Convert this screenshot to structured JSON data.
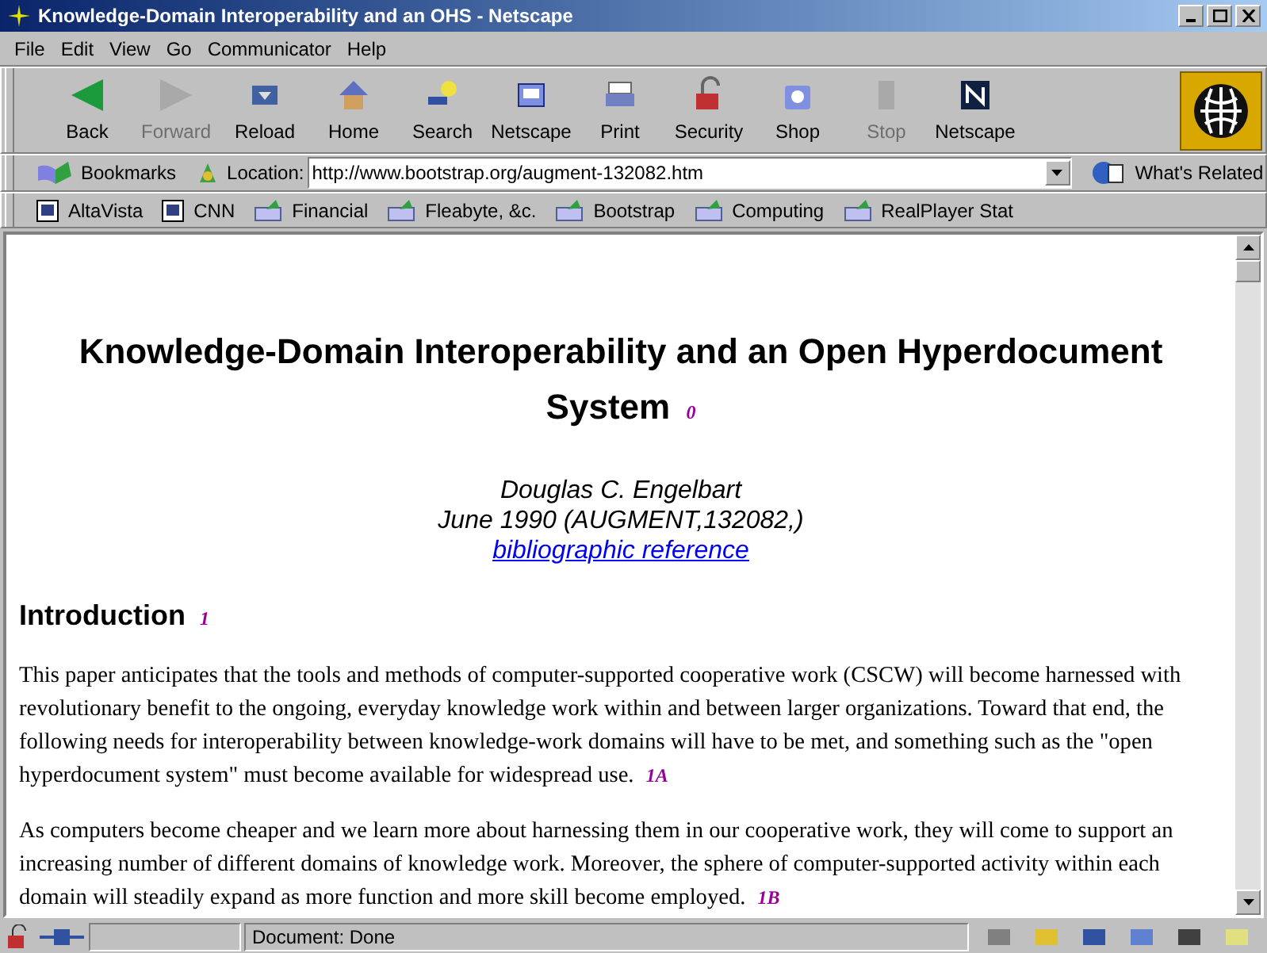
{
  "window": {
    "title": "Knowledge-Domain Interoperability and an OHS - Netscape"
  },
  "menu": [
    "File",
    "Edit",
    "View",
    "Go",
    "Communicator",
    "Help"
  ],
  "toolbar": [
    {
      "label": "Back",
      "disabled": false
    },
    {
      "label": "Forward",
      "disabled": true
    },
    {
      "label": "Reload",
      "disabled": false
    },
    {
      "label": "Home",
      "disabled": false
    },
    {
      "label": "Search",
      "disabled": false
    },
    {
      "label": "Netscape",
      "disabled": false
    },
    {
      "label": "Print",
      "disabled": false
    },
    {
      "label": "Security",
      "disabled": false
    },
    {
      "label": "Shop",
      "disabled": false
    },
    {
      "label": "Stop",
      "disabled": true
    },
    {
      "label": "Netscape",
      "disabled": false
    }
  ],
  "location_bar": {
    "bookmarks": "Bookmarks",
    "label": "Location:",
    "url": "http://www.bootstrap.org/augment-132082.htm",
    "related": "What's Related"
  },
  "personal_bar": [
    {
      "label": "AltaVista",
      "kind": "page"
    },
    {
      "label": "CNN",
      "kind": "page"
    },
    {
      "label": "Financial",
      "kind": "folder"
    },
    {
      "label": "Fleabyte, &c.",
      "kind": "folder"
    },
    {
      "label": "Bootstrap",
      "kind": "folder"
    },
    {
      "label": "Computing",
      "kind": "folder"
    },
    {
      "label": "RealPlayer Stat",
      "kind": "folder"
    }
  ],
  "document": {
    "title": "Knowledge-Domain Interoperability and an Open Hyperdocument System",
    "title_marker": "0",
    "author": "Douglas C. Engelbart",
    "date": "June 1990 (AUGMENT,132082,)",
    "reference": "bibliographic reference",
    "section": "Introduction",
    "section_marker": "1",
    "paragraphs": [
      {
        "text": "This paper anticipates that the tools and methods of computer-supported cooperative work (CSCW) will become harnessed with revolutionary benefit to the ongoing, everyday knowledge work within and between larger organizations. Toward that end, the following needs for interoperability between knowledge-work domains will have to be met, and something such as the \"open hyperdocument system\" must become available for widespread use.",
        "marker": "1A"
      },
      {
        "text": "As computers become cheaper and we learn more about harnessing them in our cooperative work, they will come to support an increasing number of different domains of knowledge work. Moreover, the sphere of computer-supported activity within each domain will steadily expand as more function and more skill become employed.",
        "marker": "1B"
      }
    ]
  },
  "status_bar": {
    "text": "Document: Done"
  }
}
